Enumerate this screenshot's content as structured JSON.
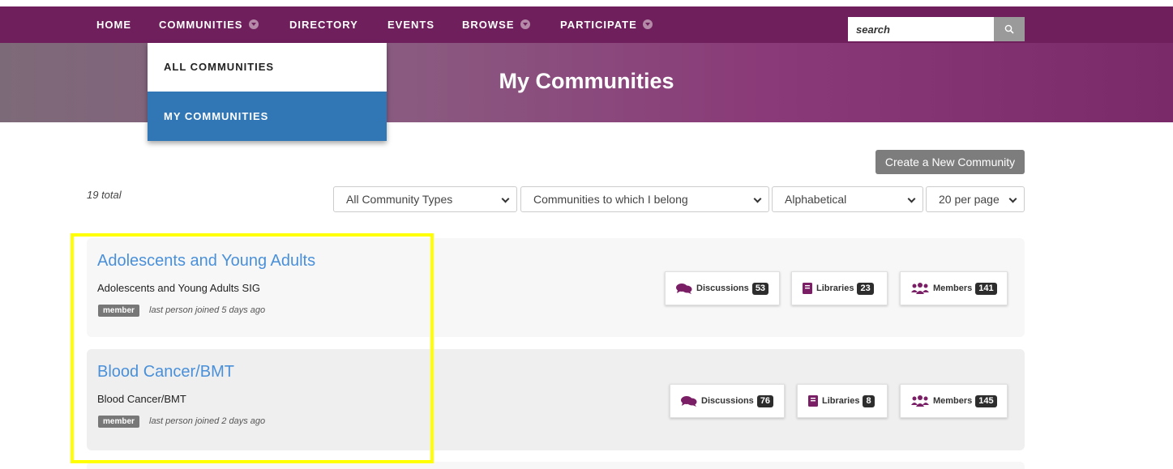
{
  "nav": {
    "home": "HOME",
    "communities": "COMMUNITIES",
    "directory": "DIRECTORY",
    "events": "EVENTS",
    "browse": "BROWSE",
    "participate": "PARTICIPATE",
    "search_placeholder": "search"
  },
  "dropdown": {
    "all_communities": "ALL COMMUNITIES",
    "my_communities": "MY COMMUNITIES"
  },
  "banner": {
    "title": "My Communities"
  },
  "toolbar": {
    "create_button": "Create a New Community",
    "total": "19 total",
    "filter_type": "All Community Types",
    "filter_membership": "Communities to which I belong",
    "sort": "Alphabetical",
    "per_page": "20 per page"
  },
  "communities": [
    {
      "title": "Adolescents and Young Adults",
      "description": "Adolescents and Young Adults SIG",
      "badge": "member",
      "joined": "last person joined 5 days ago",
      "discussions_label": "Discussions",
      "discussions_count": "53",
      "libraries_label": "Libraries",
      "libraries_count": "23",
      "members_label": "Members",
      "members_count": "141"
    },
    {
      "title": "Blood Cancer/BMT",
      "description": "Blood Cancer/BMT",
      "badge": "member",
      "joined": "last person joined 2 days ago",
      "discussions_label": "Discussions",
      "discussions_count": "76",
      "libraries_label": "Libraries",
      "libraries_count": "8",
      "members_label": "Members",
      "members_count": "145"
    }
  ],
  "colors": {
    "nav_bg": "#6f1f5c",
    "accent_icon": "#7a1f66",
    "dropdown_active": "#3277b5",
    "link": "#4a90d9",
    "highlight": "#ffff00"
  },
  "icons": {
    "search": "search-icon",
    "discussions": "chat-bubbles-icon",
    "libraries": "book-icon",
    "members": "users-icon",
    "caret": "chevron-down-circle-icon"
  }
}
